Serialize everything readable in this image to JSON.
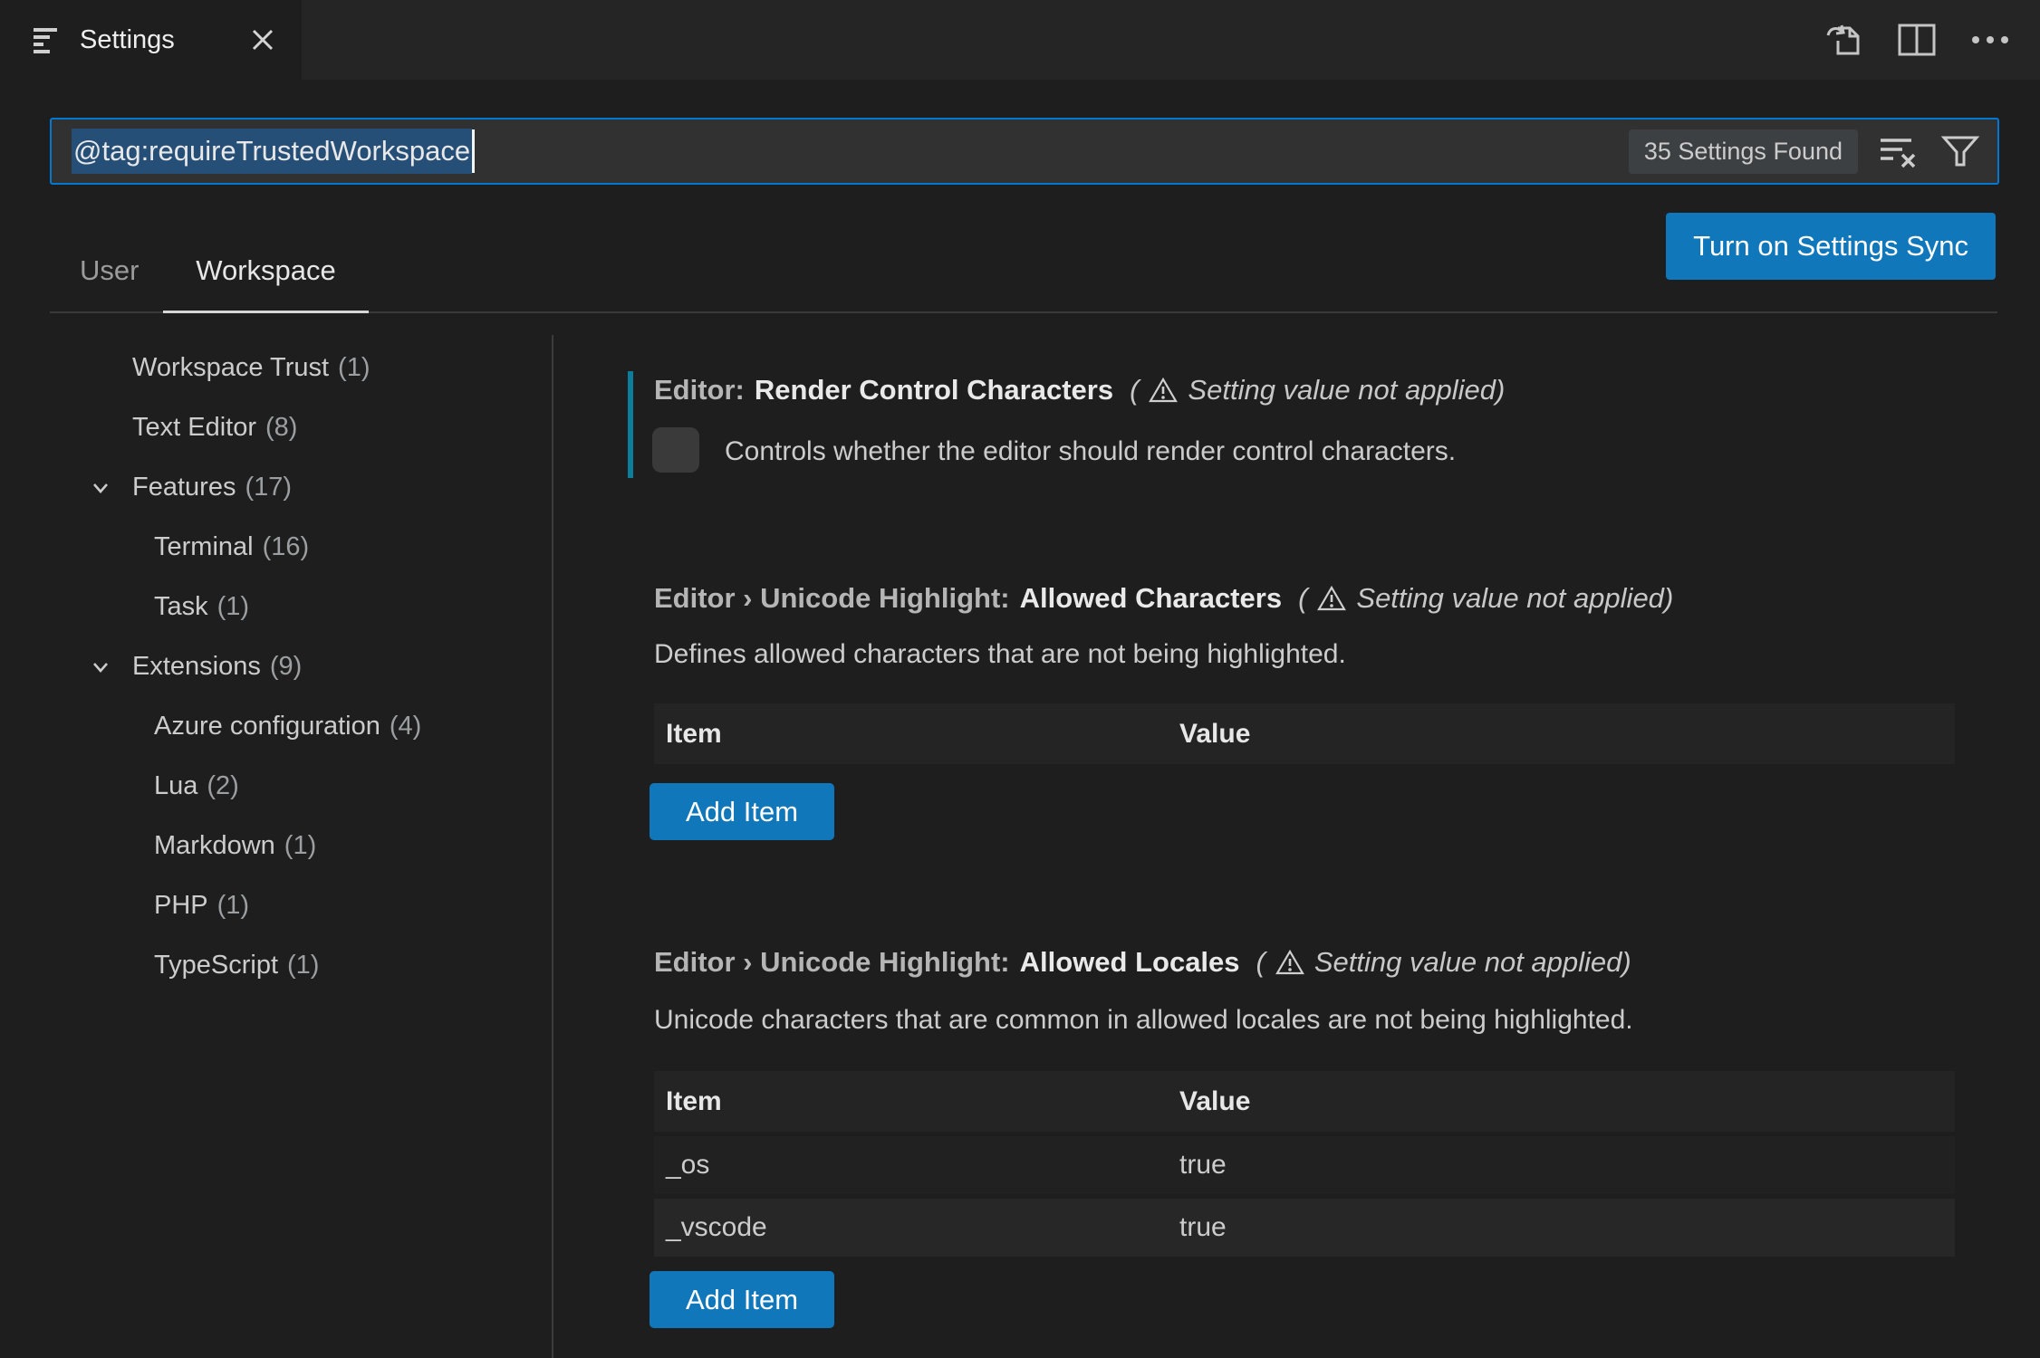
{
  "window": {
    "tab_title": "Settings",
    "icons": [
      "settings-list-icon",
      "close-icon",
      "go-to-settings-json-icon",
      "split-editor-icon",
      "more-actions-icon"
    ]
  },
  "search": {
    "query": "@tag:requireTrustedWorkspace",
    "results_badge": "35 Settings Found",
    "icons": [
      "clear-filters-icon",
      "filter-icon"
    ]
  },
  "scope": {
    "tabs": [
      {
        "label": "User",
        "active": false
      },
      {
        "label": "Workspace",
        "active": true
      }
    ],
    "sync_button_label": "Turn on Settings Sync"
  },
  "sidebar": {
    "items": [
      {
        "label": "Workspace Trust",
        "count": "(1)",
        "level": 0,
        "expandable": false
      },
      {
        "label": "Text Editor",
        "count": "(8)",
        "level": 0,
        "expandable": false
      },
      {
        "label": "Features",
        "count": "(17)",
        "level": 0,
        "expandable": true
      },
      {
        "label": "Terminal",
        "count": "(16)",
        "level": 1,
        "expandable": false
      },
      {
        "label": "Task",
        "count": "(1)",
        "level": 1,
        "expandable": false
      },
      {
        "label": "Extensions",
        "count": "(9)",
        "level": 0,
        "expandable": true
      },
      {
        "label": "Azure configuration",
        "count": "(4)",
        "level": 1,
        "expandable": false
      },
      {
        "label": "Lua",
        "count": "(2)",
        "level": 1,
        "expandable": false
      },
      {
        "label": "Markdown",
        "count": "(1)",
        "level": 1,
        "expandable": false
      },
      {
        "label": "PHP",
        "count": "(1)",
        "level": 1,
        "expandable": false
      },
      {
        "label": "TypeScript",
        "count": "(1)",
        "level": 1,
        "expandable": false
      }
    ]
  },
  "ui": {
    "warn_open": "(",
    "warn_close": ")"
  },
  "settings": [
    {
      "category": "Editor:",
      "name": "Render Control Characters",
      "warning": "Setting value not applied",
      "description": "Controls whether the editor should render control characters.",
      "control": "checkbox",
      "checked": false,
      "modified": true
    },
    {
      "category": "Editor › Unicode Highlight:",
      "name": "Allowed Characters",
      "warning": "Setting value not applied",
      "description": "Defines allowed characters that are not being highlighted.",
      "control": "table",
      "table": {
        "headers": [
          "Item",
          "Value"
        ],
        "rows": []
      },
      "add_button_label": "Add Item"
    },
    {
      "category": "Editor › Unicode Highlight:",
      "name": "Allowed Locales",
      "warning": "Setting value not applied",
      "description": "Unicode characters that are common in allowed locales are not being highlighted.",
      "control": "table",
      "table": {
        "headers": [
          "Item",
          "Value"
        ],
        "rows": [
          [
            "_os",
            "true"
          ],
          [
            "_vscode",
            "true"
          ]
        ]
      },
      "add_button_label": "Add Item"
    }
  ],
  "colors": {
    "editor_background": "#1e1e1e",
    "tabbar_background": "#252526",
    "focus_border": "#0078d4",
    "selection_background": "#264f78",
    "button_background": "#1177bb",
    "modified_indicator": "#0c7d9d",
    "table_header_background": "#242424"
  }
}
